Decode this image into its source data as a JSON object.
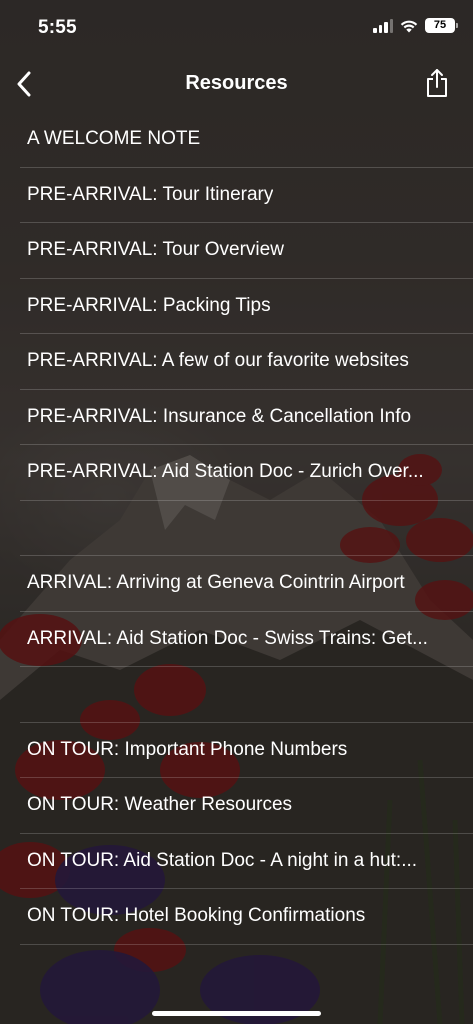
{
  "status_bar": {
    "time": "5:55",
    "battery": "75"
  },
  "nav": {
    "title": "Resources"
  },
  "list_items": [
    "A WELCOME NOTE",
    "PRE-ARRIVAL: Tour Itinerary",
    "PRE-ARRIVAL: Tour Overview",
    "PRE-ARRIVAL: Packing Tips",
    "PRE-ARRIVAL: A few of our favorite websites",
    "PRE-ARRIVAL: Insurance & Cancellation Info",
    "PRE-ARRIVAL: Aid Station Doc - Zurich Over...",
    "",
    "ARRIVAL: Arriving at Geneva Cointrin Airport",
    "ARRIVAL: Aid Station Doc - Swiss Trains: Get...",
    "",
    "ON TOUR: Important Phone Numbers",
    "ON TOUR: Weather Resources",
    "ON TOUR: Aid Station Doc - A night in a hut:...",
    "ON TOUR: Hotel Booking Confirmations"
  ],
  "icons": {
    "back": "chevron-left-icon",
    "share": "share-icon",
    "signal": "cellular-signal-icon",
    "wifi": "wifi-icon",
    "battery": "battery-icon"
  }
}
